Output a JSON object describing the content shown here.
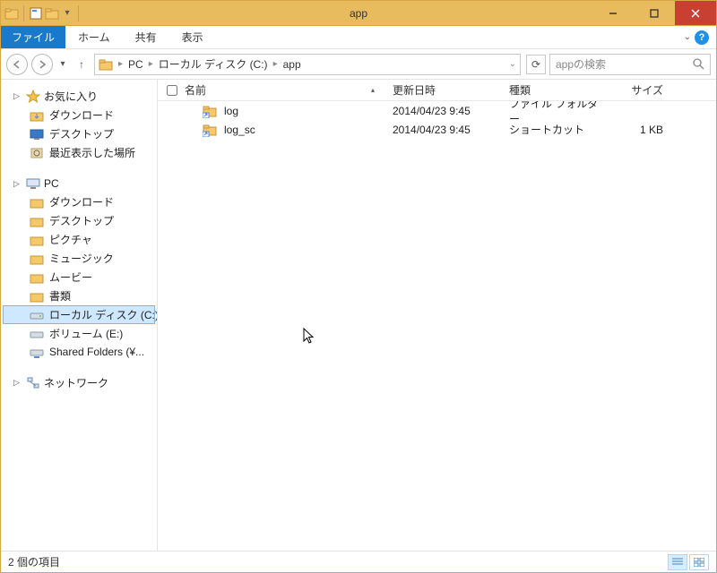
{
  "window": {
    "title": "app"
  },
  "menubar": {
    "file": "ファイル",
    "items": [
      "ホーム",
      "共有",
      "表示"
    ]
  },
  "address": {
    "crumbs": [
      "PC",
      "ローカル ディスク (C:)",
      "app"
    ]
  },
  "search": {
    "placeholder": "appの検索"
  },
  "sidebar": {
    "fav": {
      "label": "お気に入り",
      "items": [
        "ダウンロード",
        "デスクトップ",
        "最近表示した場所"
      ]
    },
    "pc": {
      "label": "PC",
      "items": [
        "ダウンロード",
        "デスクトップ",
        "ピクチャ",
        "ミュージック",
        "ムービー",
        "書類",
        "ローカル ディスク (C:)",
        "ボリューム (E:)",
        "Shared Folders (¥..."
      ]
    },
    "net": {
      "label": "ネットワーク"
    }
  },
  "columns": {
    "name": "名前",
    "date": "更新日時",
    "type": "種類",
    "size": "サイズ"
  },
  "files": [
    {
      "name": "log",
      "date": "2014/04/23 9:45",
      "type": "ファイル フォルダー",
      "size": ""
    },
    {
      "name": "log_sc",
      "date": "2014/04/23 9:45",
      "type": "ショートカット",
      "size": "1 KB"
    }
  ],
  "status": {
    "count": "2 個の項目"
  }
}
